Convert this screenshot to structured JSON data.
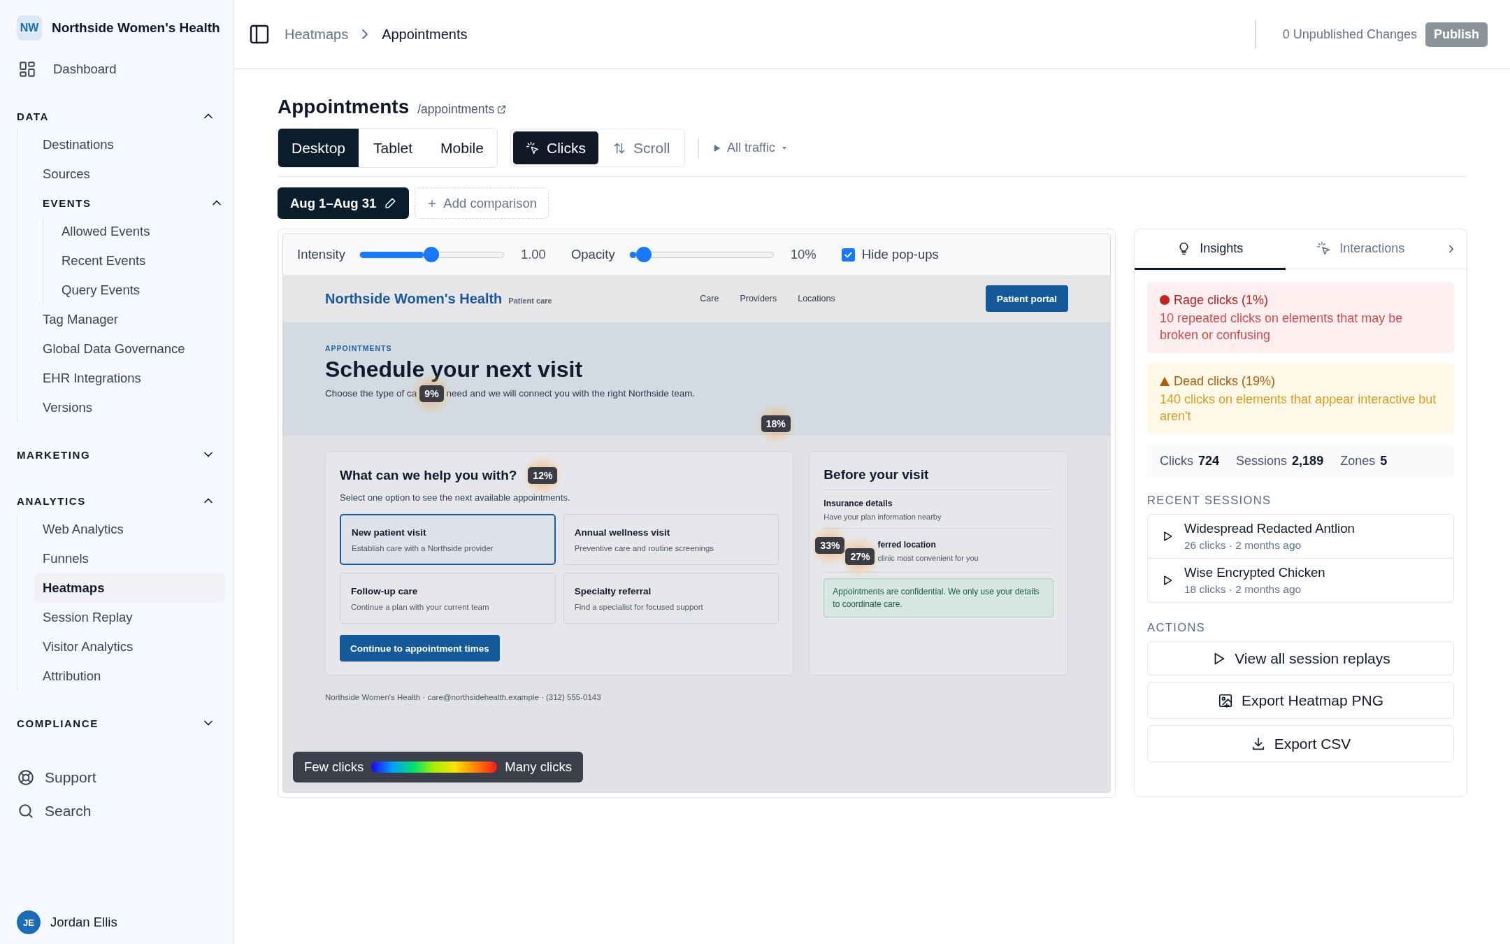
{
  "sidebar": {
    "org": {
      "initials": "NW",
      "name": "Northside Women's Health"
    },
    "top_items": [
      {
        "label": "Dashboard",
        "kind": "dashboard",
        "selected": false
      }
    ],
    "sections": [
      {
        "label": "DATA",
        "expanded": true,
        "items": [
          {
            "kind": "link",
            "label": "Destinations",
            "selected": false
          },
          {
            "kind": "link",
            "label": "Sources",
            "selected": false
          },
          {
            "kind": "group",
            "label": "EVENTS",
            "expanded": true,
            "children": [
              {
                "kind": "link",
                "label": "Allowed Events",
                "selected": false
              },
              {
                "kind": "link",
                "label": "Recent Events",
                "selected": false
              },
              {
                "kind": "link",
                "label": "Query Events",
                "selected": false
              }
            ]
          },
          {
            "kind": "link",
            "label": "Tag Manager",
            "selected": false
          },
          {
            "kind": "link",
            "label": "Global Data Governance",
            "selected": false
          },
          {
            "kind": "link",
            "label": "EHR Integrations",
            "selected": false
          },
          {
            "kind": "link",
            "label": "Versions",
            "selected": false
          }
        ]
      },
      {
        "label": "MARKETING",
        "expanded": false
      },
      {
        "label": "ANALYTICS",
        "expanded": true,
        "items": [
          {
            "kind": "link",
            "label": "Web Analytics",
            "selected": false
          },
          {
            "kind": "link",
            "label": "Funnels",
            "selected": false
          },
          {
            "kind": "link",
            "label": "Heatmaps",
            "selected": true
          },
          {
            "kind": "link",
            "label": "Session Replay",
            "selected": false
          },
          {
            "kind": "link",
            "label": "Visitor Analytics",
            "selected": false
          },
          {
            "kind": "link",
            "label": "Attribution",
            "selected": false
          }
        ]
      },
      {
        "label": "COMPLIANCE",
        "expanded": false
      }
    ],
    "footer_items": [
      {
        "label": "Support",
        "kind": "support"
      },
      {
        "label": "Search",
        "kind": "search"
      }
    ],
    "user": {
      "initials": "JE",
      "name": "Jordan Ellis"
    }
  },
  "header": {
    "breadcrumb": [
      "Heatmaps",
      "Appointments"
    ],
    "changes": "0 Unpublished Changes",
    "publish": {
      "label": "Publish",
      "disabled": true
    }
  },
  "page": {
    "title": "Appointments",
    "path": "/appointments",
    "devices": [
      {
        "label": "Desktop",
        "selected": true
      },
      {
        "label": "Tablet",
        "selected": false
      },
      {
        "label": "Mobile",
        "selected": false
      }
    ],
    "modes": [
      {
        "label": "Clicks",
        "kind": "clicks",
        "selected": true
      },
      {
        "label": "Scroll",
        "kind": "scroll",
        "selected": false
      }
    ],
    "traffic": "All traffic",
    "date": "Aug 1–Aug 31",
    "compare": "Add comparison"
  },
  "controls": {
    "intensity": {
      "label": "Intensity",
      "level": 0.5,
      "reading": "1.00"
    },
    "opacity": {
      "label": "Opacity",
      "level": 0.1,
      "reading": "10%"
    },
    "hide_popups": {
      "label": "Hide pop-ups",
      "checked": true
    }
  },
  "preview": {
    "brand": "Northside Women's Health",
    "tagline": "Patient care",
    "nav": [
      "Care",
      "Providers",
      "Locations"
    ],
    "portal": "Patient portal",
    "eyebrow": "APPOINTMENTS",
    "heading": "Schedule your next visit",
    "intro_before": "Choose the type of ca",
    "intro_badge": "9%",
    "intro_after": "need and we will connect you with the right Northside team.",
    "hero_badge": "18%",
    "help": {
      "title": "What can we help you with?",
      "badge": "12%",
      "subtitle": "Select one option to see the next available appointments.",
      "options": [
        {
          "title": "New patient visit",
          "desc": "Establish care with a Northside provider",
          "selected": true
        },
        {
          "title": "Annual wellness visit",
          "desc": "Preventive care and routine screenings",
          "selected": false
        },
        {
          "title": "Follow-up care",
          "desc": "Continue a plan with your current team",
          "selected": false
        },
        {
          "title": "Specialty referral",
          "desc": "Find a specialist for focused support",
          "selected": false
        }
      ],
      "cta": "Continue to appointment times"
    },
    "before": {
      "title": "Before your visit",
      "items": [
        {
          "title": "Insurance details",
          "desc": "Have your plan information nearby"
        },
        {
          "title": "ferred location",
          "desc": "clinic most convenient for you",
          "badges": [
            "33%",
            "27%"
          ]
        }
      ],
      "note": "Appointments are confidential. We only use your details to coordinate care."
    },
    "footer": "Northside Women's Health · care@northsidehealth.example · (312) 555-0143",
    "legend": {
      "low": "Few clicks",
      "high": "Many clicks"
    }
  },
  "insights": {
    "tabs": [
      {
        "label": "Insights",
        "kind": "bulb",
        "selected": true
      },
      {
        "label": "Interactions",
        "kind": "cursor",
        "selected": false
      }
    ],
    "alerts": [
      {
        "kind": "rage",
        "title": "Rage clicks (1%)",
        "text": "10 repeated clicks on elements that may be broken or confusing"
      },
      {
        "kind": "dead",
        "title": "Dead clicks (19%)",
        "text": "140 clicks on elements that appear interactive but aren't"
      }
    ],
    "stats": [
      {
        "label": "Clicks",
        "value": "724"
      },
      {
        "label": "Sessions",
        "value": "2,189"
      },
      {
        "label": "Zones",
        "value": "5"
      }
    ],
    "recent_title": "RECENT SESSIONS",
    "sessions": [
      {
        "name": "Widespread Redacted Antlion",
        "meta": "26 clicks · 2 months ago"
      },
      {
        "name": "Wise Encrypted Chicken",
        "meta": "18 clicks · 2 months ago"
      }
    ],
    "actions_title": "ACTIONS",
    "actions": [
      {
        "label": "View all session replays",
        "kind": "play"
      },
      {
        "label": "Export Heatmap PNG",
        "kind": "image"
      },
      {
        "label": "Export CSV",
        "kind": "download"
      }
    ]
  }
}
